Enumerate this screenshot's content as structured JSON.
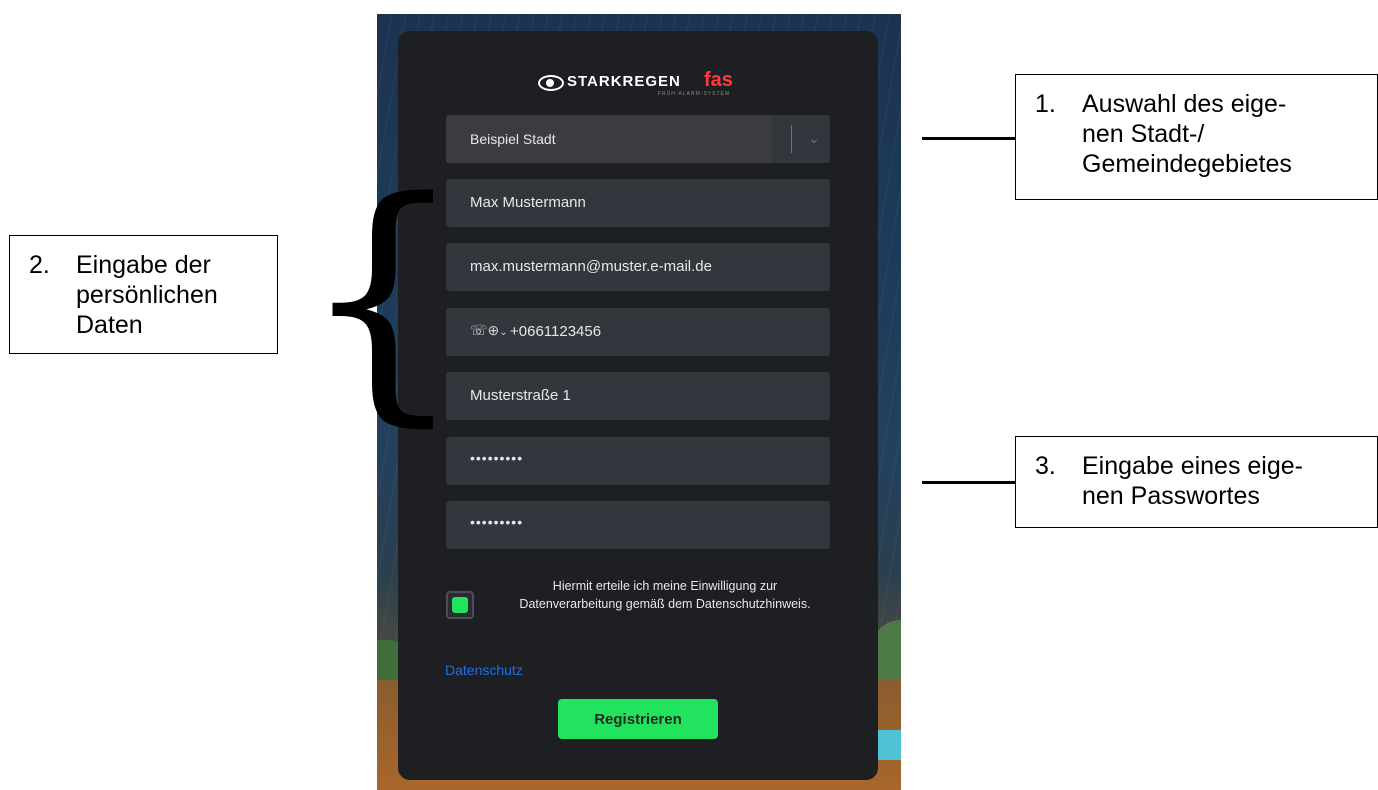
{
  "form": {
    "city_select": "Beispiel Stadt",
    "name": "Max Mustermann",
    "email": "max.mustermann@muster.e-mail.de",
    "phone": "+0661123456",
    "street": "Musterstraße 1",
    "password": "•••••••••",
    "password_repeat": "•••••••••",
    "consent_text": "Hiermit erteile ich meine Einwilligung zur Datenverarbeitung gemäß dem Datenschutzhinweis.",
    "privacy_link": "Datenschutz",
    "submit_label": "Registrieren"
  },
  "logo": {
    "brand": "STARKREGEN",
    "brand_suffix": "fas",
    "tagline": "FRÜH-ALARM-SYSTEM"
  },
  "annotations": {
    "a1": {
      "num": "1.",
      "lines": [
        "Auswahl des eige-",
        "nen Stadt-/",
        "Gemeindegebietes"
      ]
    },
    "a2": {
      "num": "2.",
      "lines": [
        "Eingabe der",
        "persönlichen",
        "Daten"
      ]
    },
    "a3": {
      "num": "3.",
      "lines": [
        "Eingabe eines eige-",
        "nen Passwortes"
      ]
    }
  },
  "colors": {
    "card_bg": "#1e1f23",
    "field_bg": "#33363d",
    "accent_green": "#22e35e",
    "link_blue": "#1f6fe0",
    "logo_red": "#ff3b3b"
  },
  "icons": [
    "eye-icon",
    "chevron-down-icon",
    "phone-icon",
    "globe-icon"
  ]
}
